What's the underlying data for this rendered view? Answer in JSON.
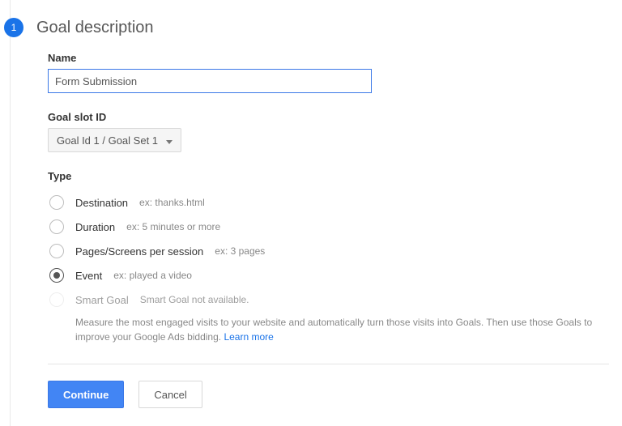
{
  "step": {
    "number": "1",
    "title": "Goal description"
  },
  "name": {
    "label": "Name",
    "value": "Form Submission"
  },
  "slot": {
    "label": "Goal slot ID",
    "selected": "Goal Id 1 / Goal Set 1"
  },
  "type": {
    "label": "Type",
    "options": [
      {
        "key": "destination",
        "label": "Destination",
        "example": "ex: thanks.html",
        "selected": false,
        "disabled": false
      },
      {
        "key": "duration",
        "label": "Duration",
        "example": "ex: 5 minutes or more",
        "selected": false,
        "disabled": false
      },
      {
        "key": "pages",
        "label": "Pages/Screens per session",
        "example": "ex: 3 pages",
        "selected": false,
        "disabled": false
      },
      {
        "key": "event",
        "label": "Event",
        "example": "ex: played a video",
        "selected": true,
        "disabled": false
      },
      {
        "key": "smart",
        "label": "Smart Goal",
        "example": "Smart Goal not available.",
        "selected": false,
        "disabled": true
      }
    ],
    "smart_desc": "Measure the most engaged visits to your website and automatically turn those visits into Goals. Then use those Goals to improve your Google Ads bidding.",
    "learn_more": "Learn more"
  },
  "actions": {
    "continue": "Continue",
    "cancel": "Cancel"
  }
}
